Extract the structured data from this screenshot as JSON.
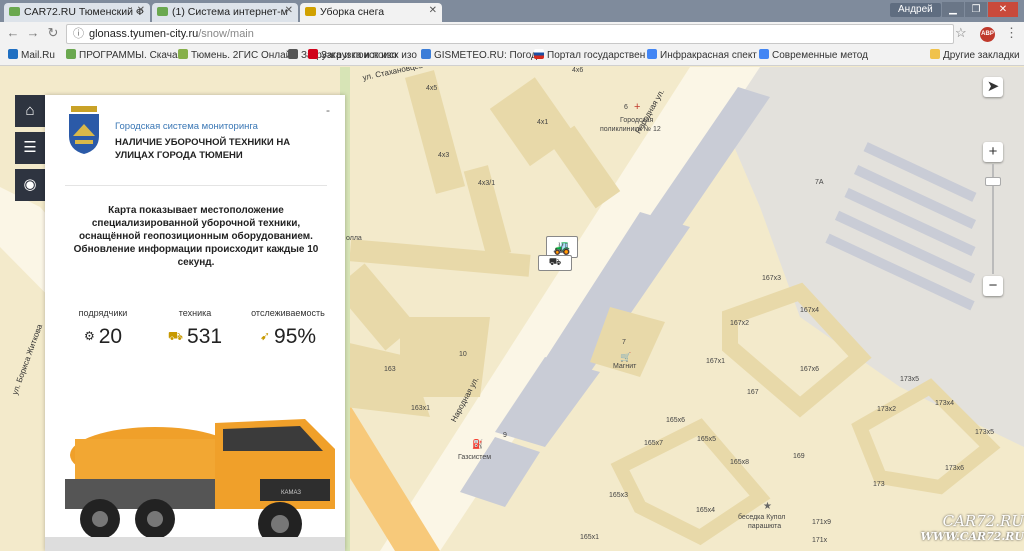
{
  "browser": {
    "tabs": [
      {
        "label": "CAR72.RU Тюменский Ф",
        "color": "#6aa84f"
      },
      {
        "label": "(1) Система интернет-м",
        "color": "#6aa84f"
      },
      {
        "label": "Уборка снега",
        "color": "#d1a100"
      }
    ],
    "profile": "Андрей",
    "url_host": "glonass.tyumen-city.ru",
    "url_path": "/snow/main",
    "extension_label": "ABP",
    "bookmarks": [
      {
        "label": "Mail.Ru",
        "color": "#1f6fc2"
      },
      {
        "label": "ПРОГРАММЫ. Скача",
        "color": "#6aa84f"
      },
      {
        "label": "Тюмень. 2ГИС Онлай",
        "color": "#86b04a"
      },
      {
        "label": "Загрузка и поиск изо",
        "color": "#555555"
      },
      {
        "label": "Загрузка и поиск изо",
        "color": "#d0021b"
      },
      {
        "label": "GISMETEO.RU: Погод",
        "color": "#3b7dd8"
      },
      {
        "label": "Портал государствен",
        "color": "#1b4fa3"
      },
      {
        "label": "Инфракрасная спект",
        "color": "#4285f4"
      },
      {
        "label": "Современные метод",
        "color": "#4285f4"
      }
    ],
    "other_bookmarks": "Другие закладки"
  },
  "nav": {
    "home_icon": "home-icon",
    "list_icon": "list-icon",
    "camera_icon": "camera-icon"
  },
  "panel": {
    "subtitle": "Городская система мониторинга",
    "title": "НАЛИЧИЕ УБОРОЧНОЙ ТЕХНИКИ НА УЛИЦАХ ГОРОДА ТЮМЕНИ",
    "minimize": "-",
    "description": "Карта показывает местоположение специализированной уборочной техники, оснащённой геопозиционным оборудованием. Обновление информации происходит каждые 10 секунд.",
    "stats": [
      {
        "label": "подрядчики",
        "value": "20"
      },
      {
        "label": "техника",
        "value": "531"
      },
      {
        "label": "отслеживаемость",
        "value": "95%"
      }
    ],
    "truck_text": "КАМАЗ"
  },
  "map": {
    "streets": {
      "stakhanovtsev": "ул. Стахановцев",
      "narodnaya_top": "Народная ул.",
      "narodnaya_bottom": "Народная ул.",
      "borisa": "ул. Бориса Житкова"
    },
    "labels": {
      "b4x5": "4х5",
      "b4x6": "4х6",
      "b4x1": "4х1",
      "b4x3": "4х3",
      "b4x3_1": "4х3/1",
      "b6": "6",
      "clinic1": "Городская",
      "clinic2": "поликлиника № 12",
      "b7a": "7А",
      "b167x3": "167х3",
      "b167x2": "167х2",
      "b167x4": "167х4",
      "b167x1": "167х1",
      "b167x6": "167х6",
      "b167": "167",
      "b7": "7",
      "magnit": "Магнит",
      "b163": "163",
      "b163x1": "163х1",
      "b10": "10",
      "b9": "9",
      "gazsistem": "Газсистем",
      "b165x6": "165х6",
      "b165x7": "165х7",
      "b165x5": "165х5",
      "b165x8": "165х8",
      "b169": "169",
      "b173x5a": "173х5",
      "b173x2": "173х2",
      "b173x4": "173х4",
      "b173x5b": "173х5",
      "b173x6": "173х6",
      "b173": "173",
      "b165x3": "165х3",
      "b165x4": "165х4",
      "b165x1": "165х1",
      "b171x9": "171х9",
      "b171x": "171х",
      "besedka1": "беседка Купол",
      "besedka2": "парашюта",
      "shkola": "олла"
    },
    "controls": {
      "zoom_in": "+",
      "zoom_out": "−"
    }
  },
  "watermark": {
    "line1": "CAR72.RU",
    "line2": "WWW.CAR72.RU"
  }
}
